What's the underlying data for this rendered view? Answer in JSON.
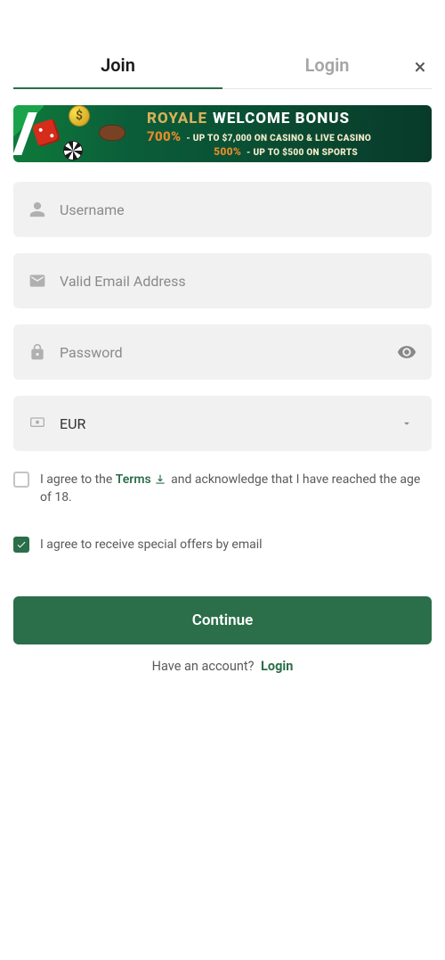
{
  "close": {
    "label": "×"
  },
  "tabs": {
    "join": "Join",
    "login": "Login"
  },
  "banner": {
    "title_royale": "ROYALE",
    "title_welcome": "WELCOME BONUS",
    "line2_pct": "700%",
    "line2_rest": "- UP TO $7,000 ON CASINO & LIVE CASINO",
    "line3_pct": "500%",
    "line3_rest": "- UP TO $500 ON SPORTS",
    "coin_symbol": "$"
  },
  "form": {
    "username_placeholder": "Username",
    "email_placeholder": "Valid Email Address",
    "password_placeholder": "Password",
    "currency_value": "EUR"
  },
  "checks": {
    "terms_pre": "I agree to the ",
    "terms_word": "Terms",
    "terms_post": " and acknowledge that I have reached the age of 18.",
    "offers": "I agree to receive special offers by email",
    "terms_checked": false,
    "offers_checked": true
  },
  "actions": {
    "continue": "Continue",
    "have_account": "Have an account?",
    "login": "Login"
  }
}
